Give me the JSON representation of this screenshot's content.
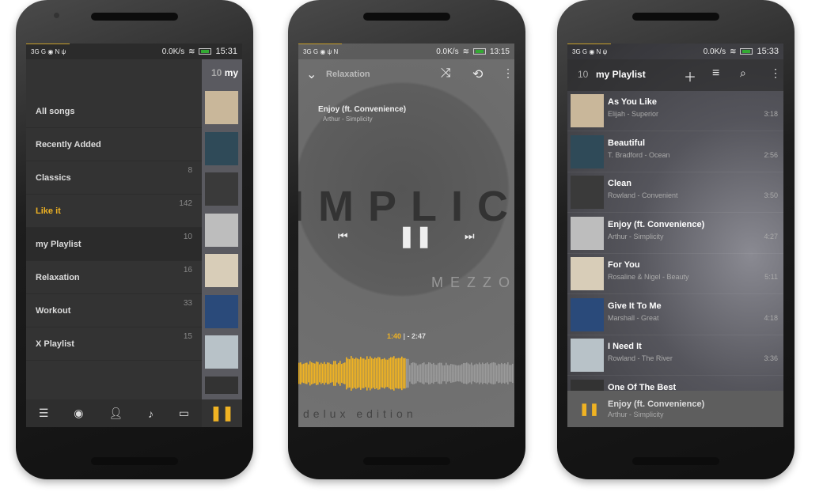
{
  "colors": {
    "accent": "#f0b323",
    "drawer_bg": "#333333",
    "player_bg": "#6e6e6e"
  },
  "phone1": {
    "status": {
      "left": "3G  G  ◉ N ψ",
      "speed": "0.0K/s",
      "time": "15:31"
    },
    "peek_header": {
      "count": "10",
      "title": "my"
    },
    "drawer": [
      {
        "label": "All songs",
        "count": ""
      },
      {
        "label": "Recently Added",
        "count": ""
      },
      {
        "label": "Classics",
        "count": "8"
      },
      {
        "label": "Like it",
        "count": "142",
        "active": true
      },
      {
        "label": "my Playlist",
        "count": "10",
        "selected": true
      },
      {
        "label": "Relaxation",
        "count": "16"
      },
      {
        "label": "Workout",
        "count": "33"
      },
      {
        "label": "X Playlist",
        "count": "15"
      }
    ],
    "bottom_nav": [
      "list-icon",
      "album-icon",
      "artist-icon",
      "song-icon",
      "folder-icon"
    ]
  },
  "phone2": {
    "status": {
      "left": "3G  G  ◉ ψ N",
      "speed": "0.0K/s",
      "time": "13:15"
    },
    "playlist": "Relaxation",
    "song_title": "Enjoy (ft. Convenience)",
    "song_sub": "Arthur - Simplicity",
    "art_text": "IMPLICI",
    "art_brand": "MEZZO",
    "art_edition": "delux edition",
    "elapsed": "1:40",
    "sep": "|",
    "remaining": "- 2:47",
    "waveform_progress": 0.5
  },
  "phone3": {
    "status": {
      "left": "3G  G  ◉ N ψ",
      "speed": "0.0K/s",
      "time": "15:33"
    },
    "count": "10",
    "title": "my Playlist",
    "songs": [
      {
        "title": "As You Like",
        "sub": "Elijah - Superior",
        "dur": "3:18",
        "art": "#c9b79a"
      },
      {
        "title": "Beautiful",
        "sub": "T. Bradford - Ocean",
        "dur": "2:56",
        "art": "#2f4a58"
      },
      {
        "title": "Clean",
        "sub": "Rowland - Convenient",
        "dur": "3:50",
        "art": "#3a3a3a"
      },
      {
        "title": "Enjoy (ft. Convenience)",
        "sub": "Arthur - Simplicity",
        "dur": "4:27",
        "art": "#bdbdbd"
      },
      {
        "title": "For You",
        "sub": "Rosaline & Nigel - Beauty",
        "dur": "5:11",
        "art": "#d8cdb8"
      },
      {
        "title": "Give It To Me",
        "sub": "Marshall - Great",
        "dur": "4:18",
        "art": "#2a4a7a"
      },
      {
        "title": "I Need It",
        "sub": "Rowland - The River",
        "dur": "3:36",
        "art": "#b8c2c8"
      },
      {
        "title": "One Of The Best",
        "sub": "",
        "dur": "",
        "art": "#333"
      }
    ],
    "now_playing": {
      "title": "Enjoy (ft. Convenience)",
      "sub": "Arthur - Simplicity"
    }
  }
}
